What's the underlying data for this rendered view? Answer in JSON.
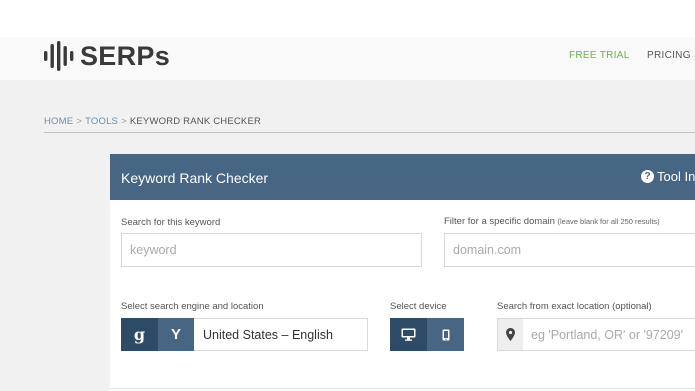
{
  "header": {
    "logo_text": "SERPs",
    "nav": {
      "free_trial": "FREE TRIAL",
      "pricing": "PRICING"
    }
  },
  "breadcrumb": {
    "home": "HOME",
    "tools": "TOOLS",
    "current": "KEYWORD RANK CHECKER",
    "separator": ">"
  },
  "card": {
    "title": "Keyword Rank Checker",
    "tool_info": "Tool Ins",
    "keyword": {
      "label": "Search for this keyword",
      "placeholder": "keyword",
      "value": ""
    },
    "domain": {
      "label": "Filter for a specific domain",
      "label_note": "(leave blank for all 250 results)",
      "placeholder": "domain.com",
      "value": ""
    },
    "engine": {
      "label": "Select search engine and location",
      "google_label": "g",
      "yahoo_label": "Y",
      "location": "United States – English"
    },
    "device": {
      "label": "Select device",
      "options": [
        "desktop-icon",
        "mobile-icon"
      ]
    },
    "exact_location": {
      "label": "Search from exact location (optional)",
      "placeholder": "eg 'Portland, OR' or '97209'",
      "value": ""
    }
  },
  "colors": {
    "header_blue": "#466683",
    "dark_blue": "#2d4b66",
    "free_trial_green": "#6ab04c",
    "link_blue": "#6b8fb4"
  }
}
